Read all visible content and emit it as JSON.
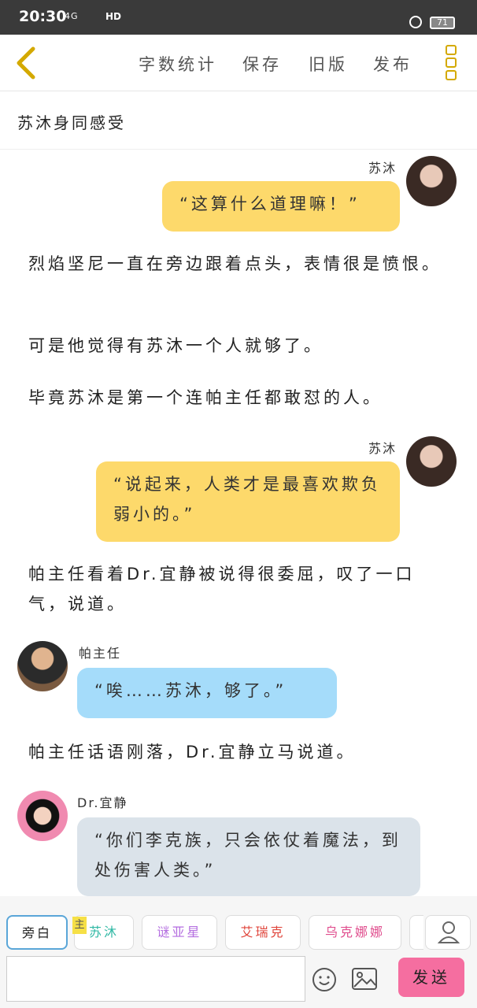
{
  "status": {
    "time": "20:30",
    "signal": "4G",
    "hd": "HD",
    "battery": "71"
  },
  "toolbar": {
    "word_count": "字数统计",
    "save": "保存",
    "old_version": "旧版",
    "publish": "发布"
  },
  "chapter_title": "苏沐身同感受",
  "messages": [
    {
      "type": "speech",
      "speaker": "苏沐",
      "text": "“这算什么道理嘛！”"
    },
    {
      "type": "narration",
      "text": "烈焰坚尼一直在旁边跟着点头，表情很是愤恨。"
    },
    {
      "type": "narration",
      "text": "可是他觉得有苏沐一个人就够了。"
    },
    {
      "type": "narration",
      "text": "毕竟苏沐是第一个连帕主任都敢怼的人。"
    },
    {
      "type": "speech",
      "speaker": "苏沐",
      "text": "“说起来，人类才是最喜欢欺负弱小的。”"
    },
    {
      "type": "narration",
      "text": "帕主任看着Dr.宜静被说得很委屈，叹了一口气，说道。"
    },
    {
      "type": "speech",
      "speaker": "帕主任",
      "text": "“唉……苏沐，够了。”"
    },
    {
      "type": "narration",
      "text": "帕主任话语刚落，Dr.宜静立马说道。"
    },
    {
      "type": "speech",
      "speaker": "Dr.宜静",
      "text": "“你们李克族，只会依仗着魔法，到处伤害人类。”"
    }
  ],
  "roles": [
    "旁白",
    "苏沐",
    "谜亚星",
    "艾瑞克",
    "乌克娜娜"
  ],
  "main_badge": "主",
  "send_label": "发送",
  "colors": {
    "yellow_bubble": "#fdd96b",
    "blue_bubble": "#a5dcfa",
    "grey_bubble": "#dbe3ea",
    "send": "#f56ea0",
    "accent": "#d4a900"
  }
}
